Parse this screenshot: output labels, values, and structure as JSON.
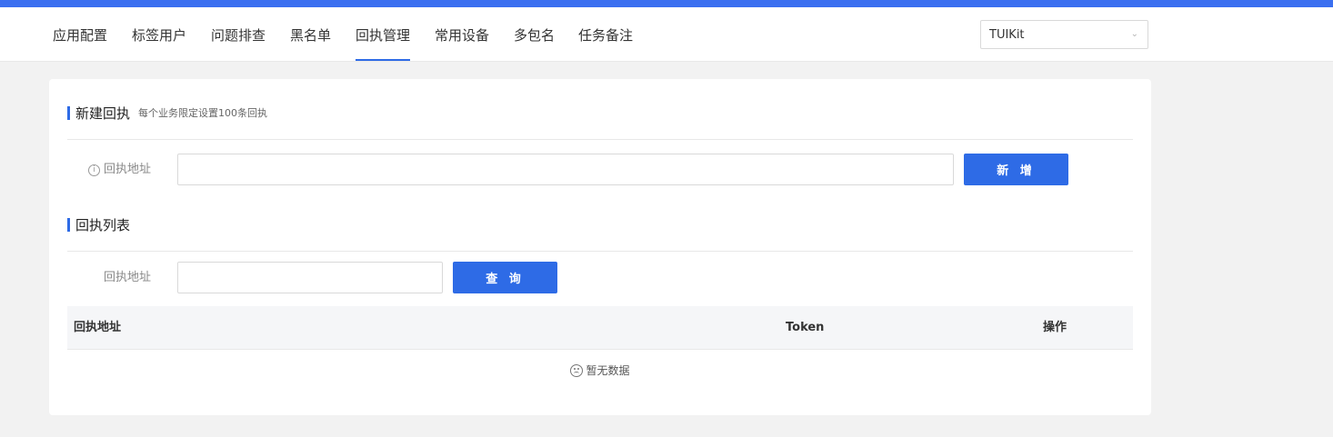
{
  "nav": {
    "tabs": [
      {
        "label": "应用配置"
      },
      {
        "label": "标签用户"
      },
      {
        "label": "问题排查"
      },
      {
        "label": "黑名单"
      },
      {
        "label": "回执管理",
        "active": true
      },
      {
        "label": "常用设备"
      },
      {
        "label": "多包名"
      },
      {
        "label": "任务备注"
      }
    ],
    "app_select": {
      "value": "TUIKit",
      "icon": "chevron-down-icon"
    }
  },
  "colors": {
    "accent": "#2e6be6",
    "top_strip": "#3a6ff0"
  },
  "new_receipt": {
    "title": "新建回执",
    "subtitle": "每个业务限定设置100条回执",
    "field_label": "回执地址",
    "field_icon": "info-circle-icon",
    "field_value": "",
    "add_button": "新 增"
  },
  "receipt_list": {
    "title": "回执列表",
    "filter_label": "回执地址",
    "filter_value": "",
    "query_button": "查 询",
    "columns": [
      "回执地址",
      "Token",
      "操作"
    ],
    "rows": [],
    "empty_text": "暂无数据",
    "empty_icon": "frown-icon"
  }
}
